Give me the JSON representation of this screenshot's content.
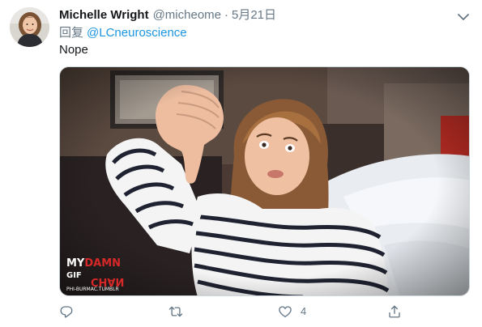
{
  "tweet": {
    "author": {
      "display_name": "Michelle Wright",
      "handle": "@micheome"
    },
    "separator": "·",
    "date": "5月21日",
    "reply_prefix": "回复",
    "reply_to": "@LCneuroscience",
    "text": "Nope",
    "media": {
      "type": "gif",
      "watermark_line1": "MY DAMN",
      "watermark_line2": "GIF",
      "watermark_line3": "CHAN",
      "watermark_line4": "PHI-BURMAC.TUMBLR"
    },
    "actions": {
      "reply_count": "",
      "retweet_count": "",
      "like_count": "4"
    }
  },
  "colors": {
    "name": "#14171a",
    "secondary": "#657786",
    "link": "#1b95e0",
    "border": "#ccd6dd"
  },
  "icons": {
    "caret": "chevron-down-icon",
    "reply": "reply-icon",
    "retweet": "retweet-icon",
    "like": "heart-icon",
    "share": "share-icon"
  }
}
